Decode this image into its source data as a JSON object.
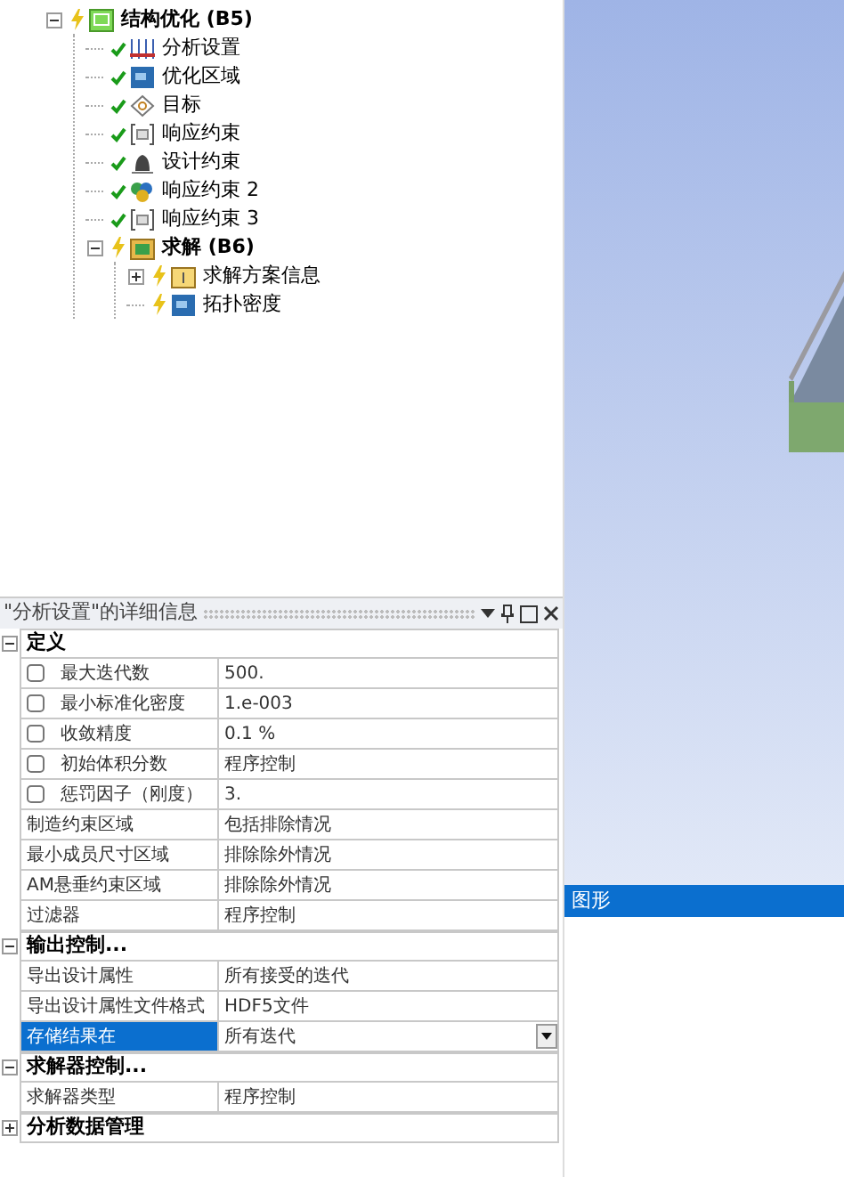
{
  "tree": [
    {
      "label": "结构优化 (B5)",
      "bold": true,
      "up_to_date": false,
      "kind": "optimization",
      "expanded": true,
      "children": [
        {
          "label": "分析设置",
          "bold": false,
          "up_to_date": true,
          "kind": "settings"
        },
        {
          "label": "优化区域",
          "bold": false,
          "up_to_date": true,
          "kind": "region"
        },
        {
          "label": "目标",
          "bold": false,
          "up_to_date": true,
          "kind": "target"
        },
        {
          "label": "响应约束",
          "bold": false,
          "up_to_date": true,
          "kind": "constraint"
        },
        {
          "label": "设计约束",
          "bold": false,
          "up_to_date": true,
          "kind": "design"
        },
        {
          "label": "响应约束 2",
          "bold": false,
          "up_to_date": true,
          "kind": "multi"
        },
        {
          "label": "响应约束 3",
          "bold": false,
          "up_to_date": true,
          "kind": "constraint"
        },
        {
          "label": "求解 (B6)",
          "bold": true,
          "up_to_date": false,
          "kind": "solution",
          "expanded": true,
          "children": [
            {
              "label": "求解方案信息",
              "bold": false,
              "up_to_date": false,
              "kind": "info",
              "expanded": false
            },
            {
              "label": "拓扑密度",
              "bold": false,
              "up_to_date": false,
              "kind": "region"
            }
          ]
        }
      ]
    }
  ],
  "details": {
    "title": "\"分析设置\"的详细信息",
    "sections": [
      {
        "header": "定义",
        "expanded": true,
        "rows": [
          {
            "kind": "checkbox",
            "checked": false,
            "label": "最大迭代数",
            "value": "500.",
            "selected": false
          },
          {
            "kind": "checkbox",
            "checked": false,
            "label": "最小标准化密度",
            "value": "1.e-003",
            "selected": false
          },
          {
            "kind": "checkbox",
            "checked": false,
            "label": "收敛精度",
            "value": "0.1 %",
            "selected": false
          },
          {
            "kind": "checkbox",
            "checked": false,
            "label": "初始体积分数",
            "value": "程序控制",
            "selected": false
          },
          {
            "kind": "checkbox",
            "checked": false,
            "label": "惩罚因子（刚度）",
            "value": "3.",
            "selected": false
          },
          {
            "kind": "plain",
            "label": "制造约束区域",
            "value": "包括排除情况",
            "selected": false
          },
          {
            "kind": "plain",
            "label": "最小成员尺寸区域",
            "value": "排除除外情况",
            "selected": false
          },
          {
            "kind": "plain",
            "label": "AM悬垂约束区域",
            "value": "排除除外情况",
            "selected": false
          },
          {
            "kind": "plain",
            "label": "过滤器",
            "value": "程序控制",
            "selected": false
          }
        ]
      },
      {
        "header": "输出控制...",
        "expanded": true,
        "rows": [
          {
            "kind": "plain",
            "label": "导出设计属性",
            "value": "所有接受的迭代",
            "selected": false
          },
          {
            "kind": "plain",
            "label": "导出设计属性文件格式",
            "value": "HDF5文件",
            "selected": false
          },
          {
            "kind": "dropdown",
            "label": "存储结果在",
            "value": "所有迭代",
            "selected": true
          }
        ]
      },
      {
        "header": "求解器控制...",
        "expanded": true,
        "rows": [
          {
            "kind": "plain",
            "label": "求解器类型",
            "value": "程序控制",
            "selected": false
          }
        ]
      },
      {
        "header": "分析数据管理",
        "expanded": false
      }
    ]
  },
  "graphics": {
    "title": "图形"
  }
}
